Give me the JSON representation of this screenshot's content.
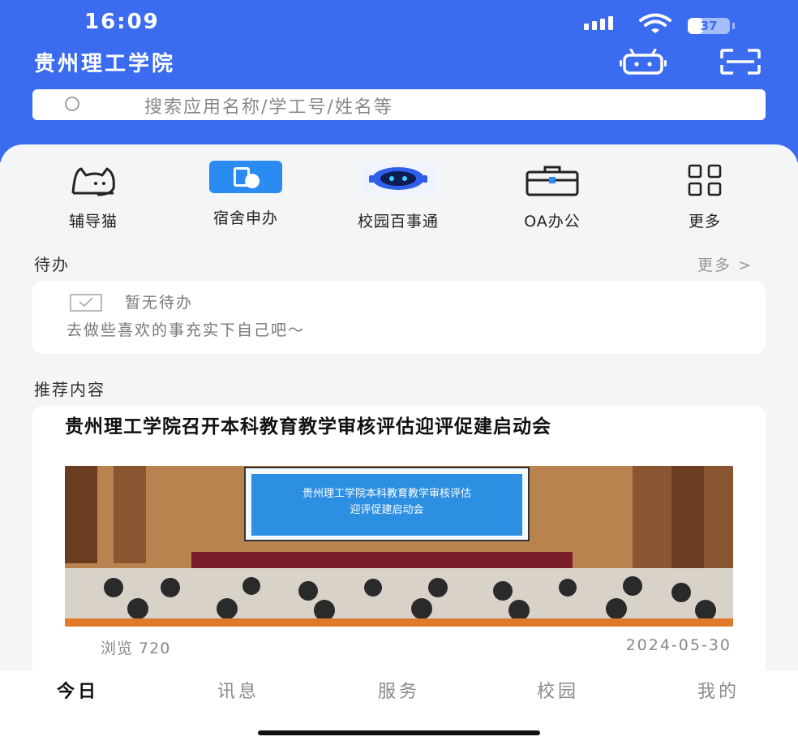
{
  "status_bar": {
    "time": "16:09",
    "battery": "37",
    "battery_level": 0.37
  },
  "header": {
    "title": "贵州理工学院"
  },
  "search": {
    "placeholder": "搜索应用名称/学工号/姓名等"
  },
  "quick_apps": [
    {
      "label": "辅导猫",
      "icon": "cat-icon"
    },
    {
      "label": "宿舍申办",
      "icon": "dorm-app-icon"
    },
    {
      "label": "校园百事通",
      "icon": "robot-icon"
    },
    {
      "label": "OA办公",
      "icon": "briefcase-icon"
    },
    {
      "label": "更多",
      "icon": "grid-icon"
    }
  ],
  "todo": {
    "title": "待办",
    "more": "更多 >",
    "empty_title": "暂无待办",
    "empty_sub": "去做些喜欢的事充实下自己吧～"
  },
  "recommend": {
    "title": "推荐内容",
    "article": {
      "title": "贵州理工学院召开本科教育教学审核评估迎评促建启动会",
      "screen_title_line1": "贵州理工学院本科教育教学审核评估",
      "screen_title_line2": "迎评促建启动会",
      "views": "浏览 720",
      "date": "2024-05-30"
    }
  },
  "tabs": [
    {
      "label": "今日",
      "active": true
    },
    {
      "label": "讯息",
      "active": false
    },
    {
      "label": "服务",
      "active": false
    },
    {
      "label": "校园",
      "active": false
    },
    {
      "label": "我的",
      "active": false
    }
  ],
  "colors": {
    "brand": "#3b6cf0",
    "background": "#f4f5f7"
  }
}
